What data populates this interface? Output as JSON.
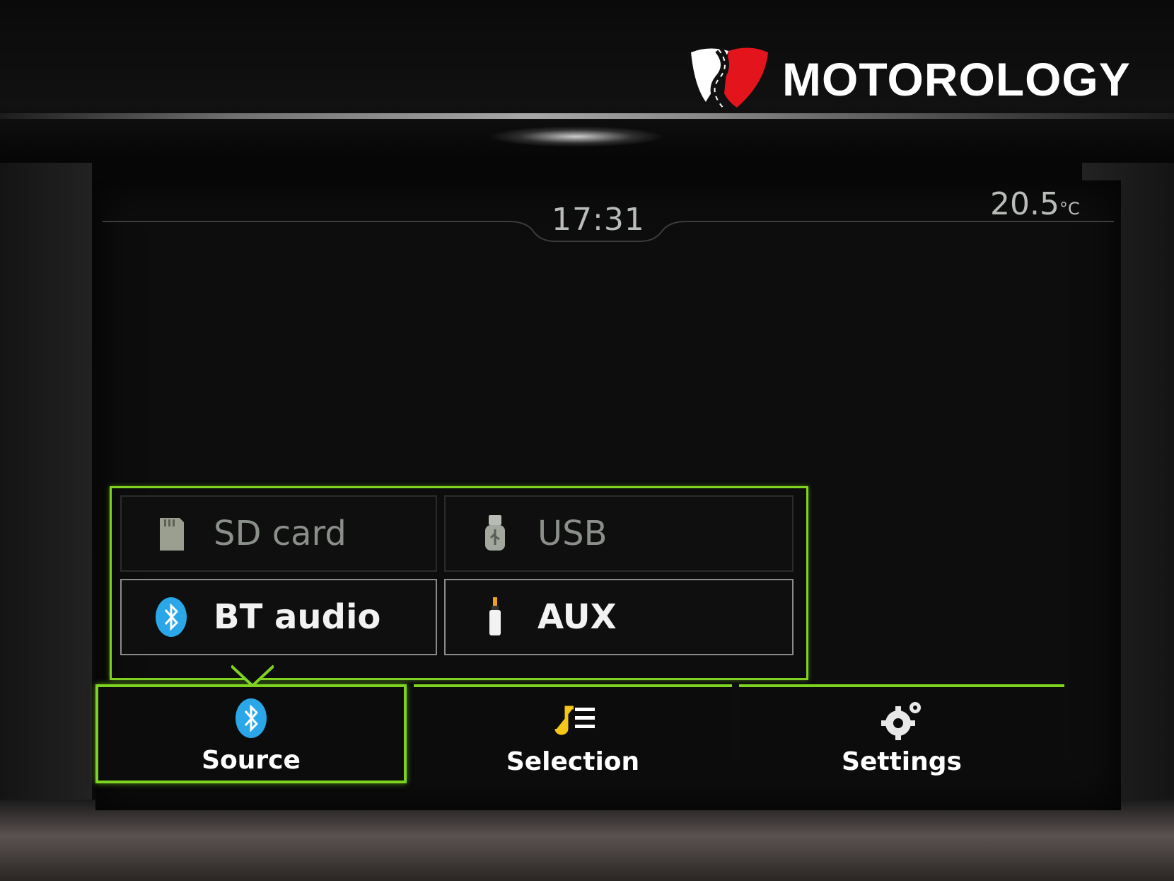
{
  "watermark": {
    "brand": "MOTOROLOGY"
  },
  "status_bar": {
    "time": "17:31",
    "temperature": "20.5",
    "temperature_unit": "°C"
  },
  "source_menu": {
    "items": [
      {
        "label": "SD card",
        "icon": "sd-card-icon",
        "state": "unavailable"
      },
      {
        "label": "USB",
        "icon": "usb-icon",
        "state": "unavailable"
      },
      {
        "label": "BT audio",
        "icon": "bluetooth-icon",
        "state": "available"
      },
      {
        "label": "AUX",
        "icon": "aux-jack-icon",
        "state": "available"
      }
    ]
  },
  "nav": {
    "items": [
      {
        "label": "Source",
        "icon": "bluetooth-icon",
        "active": true
      },
      {
        "label": "Selection",
        "icon": "music-list-icon",
        "active": false
      },
      {
        "label": "Settings",
        "icon": "gear-icon",
        "active": false
      }
    ]
  },
  "colors": {
    "accent": "#7ed321",
    "bluetooth": "#2aa7e8",
    "text_dim": "#8a8f8a",
    "text_bright": "#f2f2f2"
  }
}
